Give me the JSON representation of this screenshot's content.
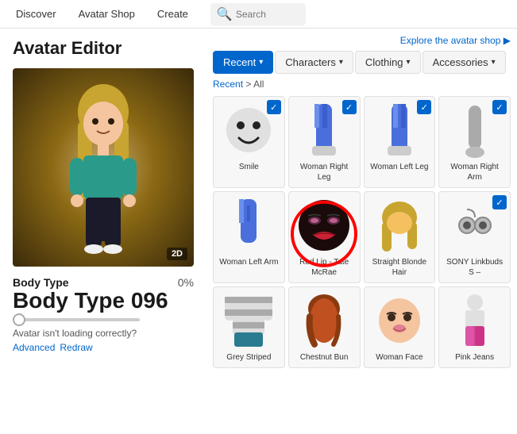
{
  "nav": {
    "items": [
      "Discover",
      "Avatar Shop",
      "Create"
    ],
    "search_placeholder": "Search"
  },
  "header": {
    "title": "Avatar Editor",
    "explore_text": "Explore the avatar shop ▶"
  },
  "tabs": [
    {
      "label": "Recent",
      "active": true,
      "id": "recent"
    },
    {
      "label": "Characters",
      "active": false,
      "id": "characters"
    },
    {
      "label": "Clothing",
      "active": false,
      "id": "clothing"
    },
    {
      "label": "Accessories",
      "active": false,
      "id": "accessories"
    }
  ],
  "breadcrumb": {
    "parent": "Recent",
    "current": "All"
  },
  "body_type": {
    "label": "Body Type",
    "value_label": "Body Type 096",
    "percent": "0%",
    "slider_value": 0
  },
  "loading_msg": "Avatar isn't loading correctly?",
  "advanced_label": "Advanced",
  "redraw_label": "Redraw",
  "badge_2d": "2D",
  "items": [
    {
      "id": "smile",
      "label": "Smile",
      "checked": true,
      "type": "face"
    },
    {
      "id": "woman-right-leg",
      "label": "Woman Right Leg",
      "checked": true,
      "type": "legs"
    },
    {
      "id": "woman-left-leg",
      "label": "Woman Left Leg",
      "checked": true,
      "type": "legs"
    },
    {
      "id": "woman-right-arm",
      "label": "Woman Right Arm",
      "checked": true,
      "type": "arms"
    },
    {
      "id": "woman-left-arm",
      "label": "Woman Left Arm",
      "checked": false,
      "type": "arms"
    },
    {
      "id": "red-lip",
      "label": "Red Lip - Tate McRae",
      "checked": false,
      "type": "face",
      "highlighted": true
    },
    {
      "id": "straight-blonde",
      "label": "Straight Blonde Hair",
      "checked": false,
      "type": "hair"
    },
    {
      "id": "sony-linkbuds",
      "label": "SONY Linkbuds S –",
      "checked": true,
      "type": "accessory"
    },
    {
      "id": "grey-striped",
      "label": "Grey Striped Shirt",
      "checked": false,
      "type": "clothing"
    },
    {
      "id": "chestnut-bun",
      "label": "Chestnut Bun",
      "checked": false,
      "type": "hair"
    },
    {
      "id": "woman-face",
      "label": "Woman Face",
      "checked": false,
      "type": "face"
    },
    {
      "id": "pink-jeans",
      "label": "Pink Jeans",
      "checked": false,
      "type": "clothing"
    }
  ]
}
